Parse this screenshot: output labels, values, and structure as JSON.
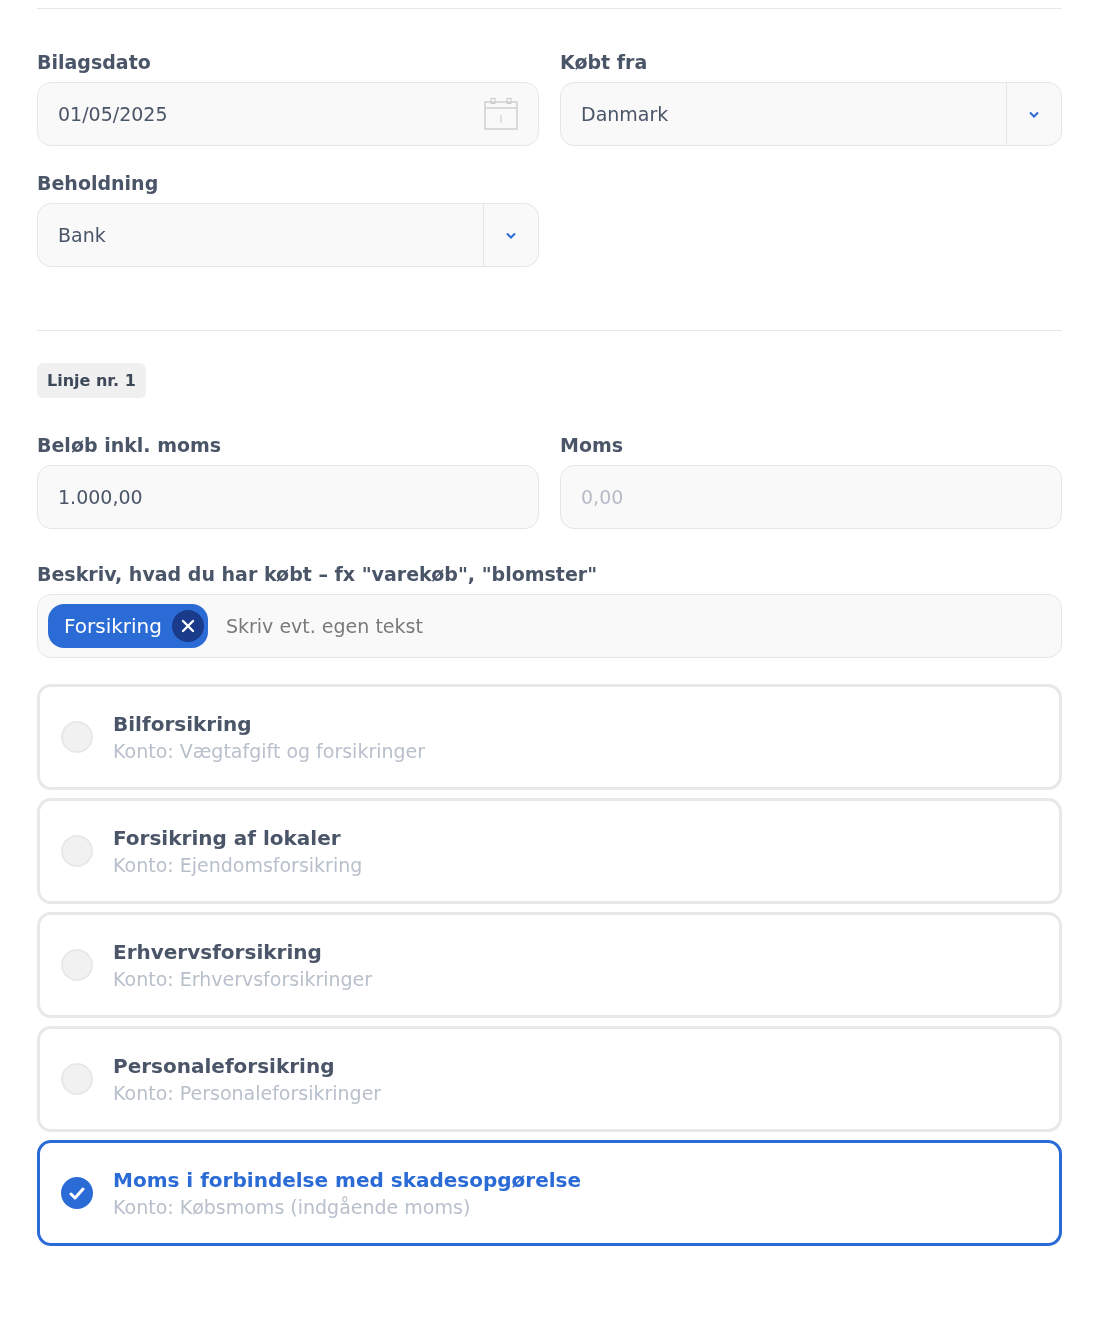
{
  "fields": [
    {
      "label": "Bilagsdato",
      "kind": "date",
      "value": "01/05/2025"
    },
    {
      "label": "Købt fra",
      "kind": "select",
      "value": "Danmark"
    },
    {
      "label": "Beholdning",
      "kind": "select",
      "value": "Bank"
    }
  ],
  "line_badge": "Linje nr. 1",
  "amount_fields": [
    {
      "label": "Beløb inkl. moms",
      "kind": "text",
      "value": "1.000,00"
    },
    {
      "label": "Moms",
      "kind": "text",
      "placeholder": "0,00"
    }
  ],
  "description": {
    "label": "Beskriv, hvad du har købt – fx \"varekøb\", \"blomster\"",
    "tags": [
      "Forsikring"
    ],
    "placeholder": "Skriv evt. egen tekst"
  },
  "options": [
    {
      "title": "Bilforsikring",
      "account": "Konto: Vægtafgift og forsikringer",
      "selected": false
    },
    {
      "title": "Forsikring af lokaler",
      "account": "Konto: Ejendomsforsikring",
      "selected": false
    },
    {
      "title": "Erhvervsforsikring",
      "account": "Konto: Erhvervsforsikringer",
      "selected": false
    },
    {
      "title": "Personaleforsikring",
      "account": "Konto: Personaleforsikringer",
      "selected": false
    },
    {
      "title": "Moms i forbindelse med skadesopgørelse",
      "account": "Konto: Købsmoms (indgående moms)",
      "selected": true
    }
  ]
}
